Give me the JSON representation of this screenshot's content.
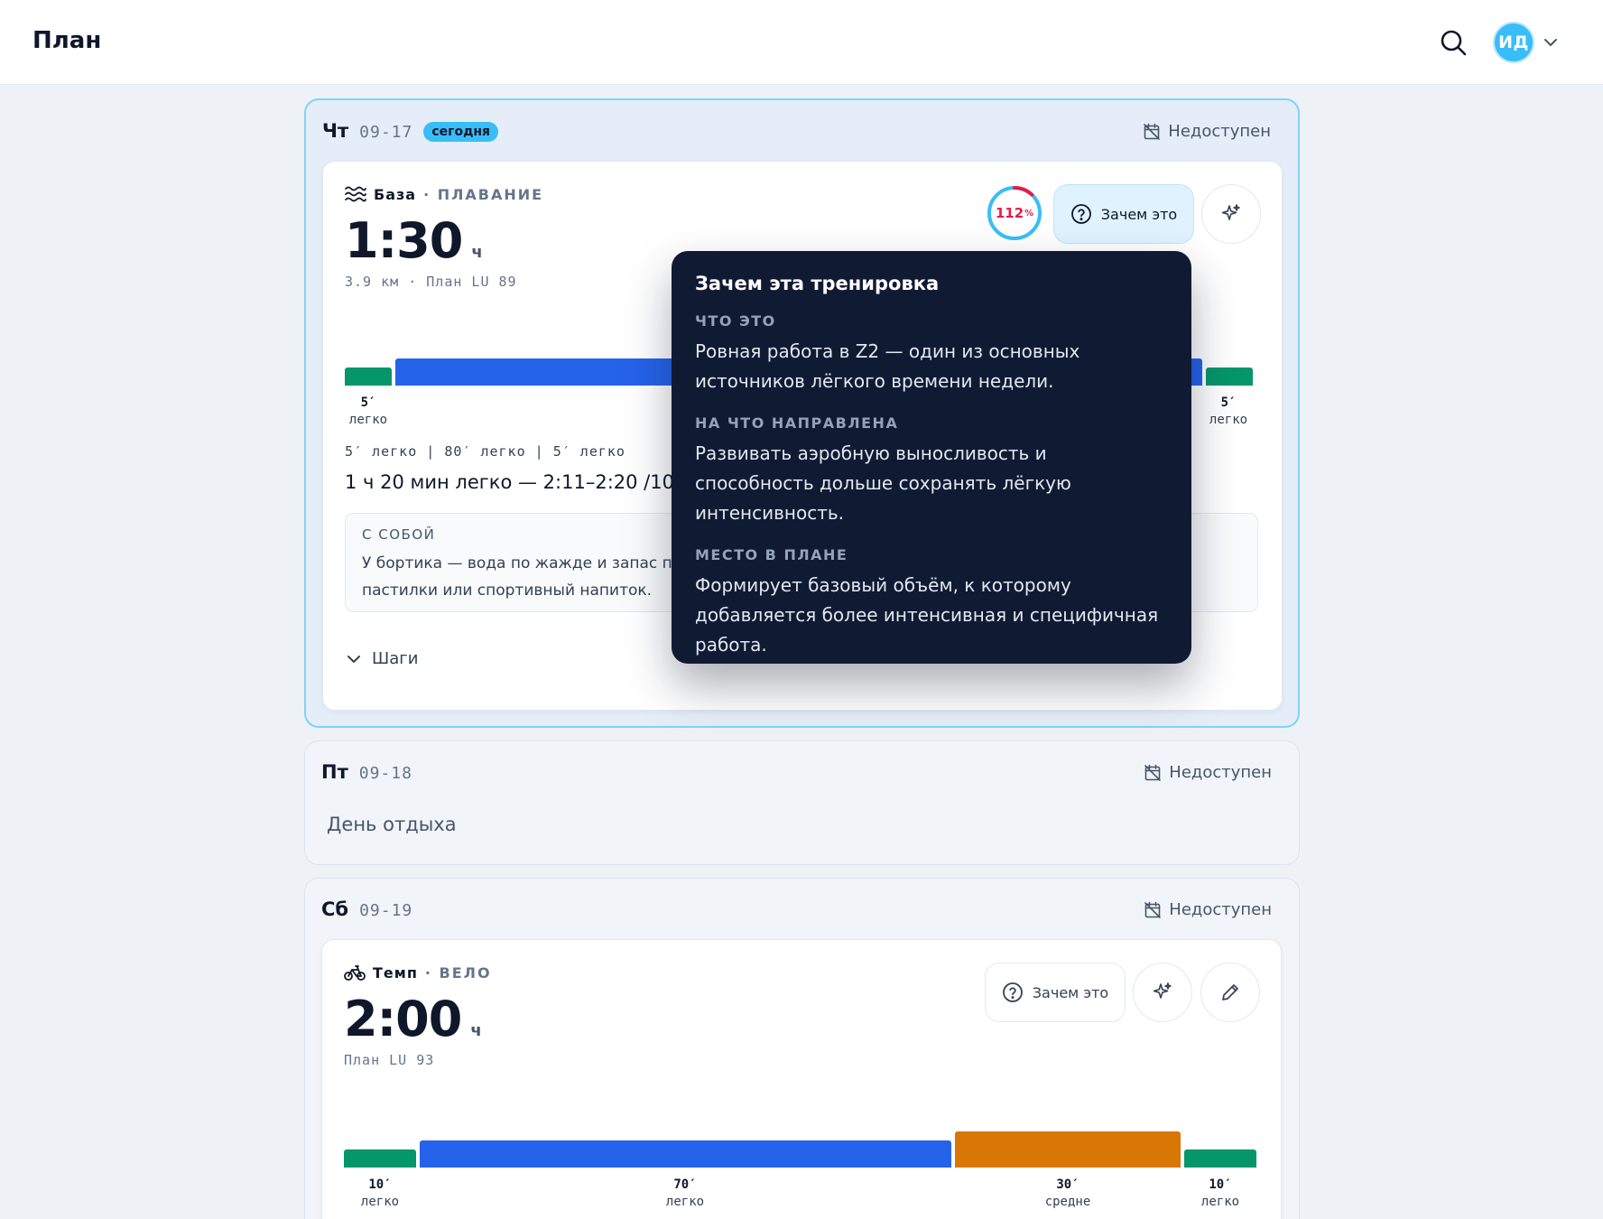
{
  "header": {
    "title": "План",
    "avatar_initials": "ИД",
    "search_icon": "search-icon",
    "menu_icon": "chevron-down-icon"
  },
  "days": [
    {
      "dow": "Чт",
      "date": "09-17",
      "badge": "сегодня",
      "status": "Недоступен",
      "workout": {
        "type": "База",
        "sport": "· ПЛАВАНИЕ",
        "sport_icon": "waves-icon",
        "duration": "1:30",
        "duration_unit": "ч",
        "meta": "3.9 км · План LU 89",
        "compliance_percent": 112,
        "compliance_value": "112",
        "compliance_unit": "%",
        "why_label": "Зачем это",
        "segments": [
          {
            "minutes": "5′",
            "zone": "легко"
          },
          {
            "minutes": "80′",
            "zone": "легко"
          },
          {
            "minutes": "5′",
            "zone": "легко"
          }
        ],
        "steps_line": "5′ легко | 80′ легко | 5′ легко",
        "summary": "1 ч 20 мин легко — 2:11–2:20 /100м",
        "bring_title": "С СОБОЙ",
        "bring_text": "У бортика — вода по жажде и запас пр пастилки или спортивный напиток.",
        "steps_toggle": "Шаги"
      }
    },
    {
      "dow": "Пт",
      "date": "09-18",
      "status": "Недоступен",
      "rest": "День отдыха"
    },
    {
      "dow": "Сб",
      "date": "09-19",
      "status": "Недоступен",
      "workout": {
        "type": "Темп",
        "sport": "· ВЕЛО",
        "sport_icon": "bike-icon",
        "duration": "2:00",
        "duration_unit": "ч",
        "meta": "План LU 93",
        "why_label": "Зачем это",
        "segments": [
          {
            "minutes": "10′",
            "zone": "легко"
          },
          {
            "minutes": "70′",
            "zone": "легко"
          },
          {
            "minutes": "30′",
            "zone": "средне"
          },
          {
            "minutes": "10′",
            "zone": "легко"
          }
        ]
      }
    }
  ],
  "popover": {
    "title": "Зачем эта тренировка",
    "sections": [
      {
        "heading": "ЧТО ЭТО",
        "text": "Ровная работа в Z2 — один из основных источников лёгкого времени недели."
      },
      {
        "heading": "НА ЧТО НАПРАВЛЕНА",
        "text": "Развивать аэробную выносливость и способность дольше сохранять лёгкую интенсивность."
      },
      {
        "heading": "МЕСТО В ПЛАНЕ",
        "text": "Формирует базовый объём, к которому добавляется более интенсивная и специфичная работа."
      }
    ]
  },
  "colors": {
    "accent": "#38bdf8",
    "easy": "#059669",
    "steady": "#2563eb",
    "moderate": "#d97706",
    "over_target": "#e11d48",
    "popover_bg": "#101a33"
  }
}
